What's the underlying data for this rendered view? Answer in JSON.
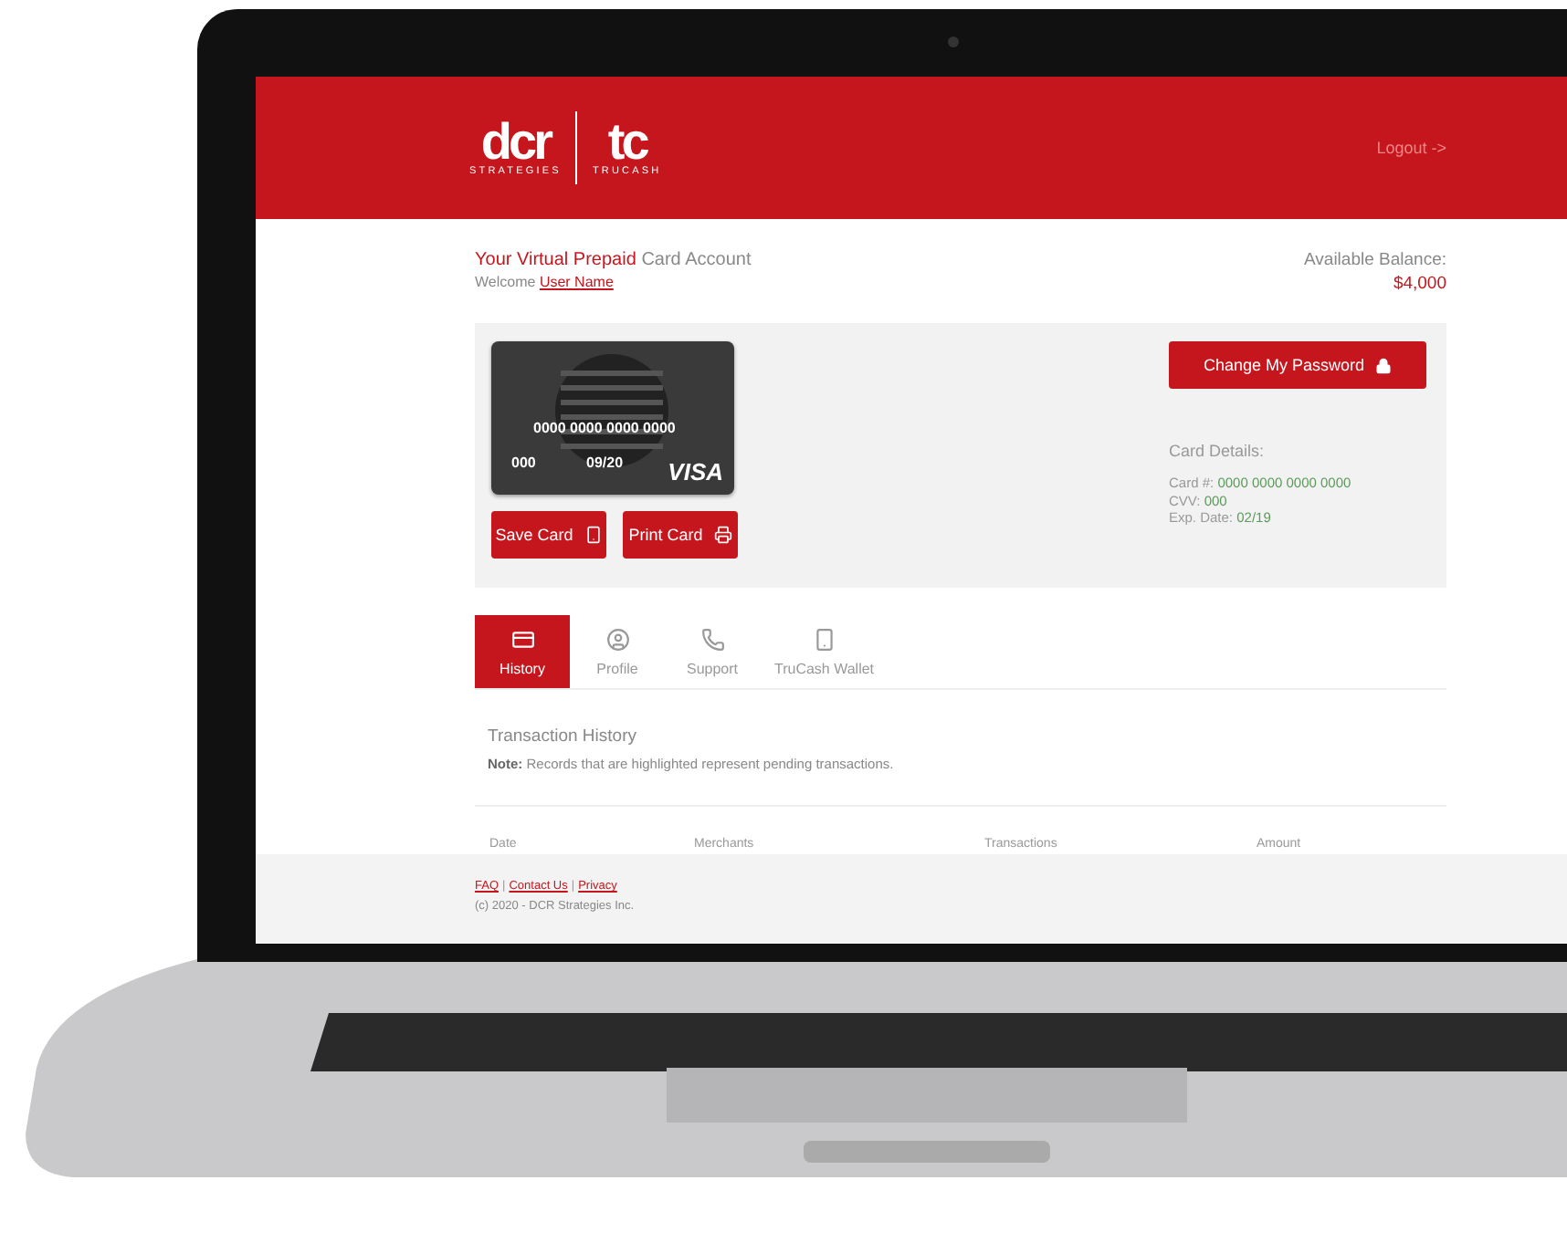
{
  "header": {
    "logo": {
      "left_mark": "dcr",
      "left_caption": "STRATEGIES",
      "right_mark": "tc",
      "right_caption": "TRUCASH"
    },
    "logout": "Logout ->"
  },
  "account": {
    "title_highlight": "Your Virtual Prepaid",
    "title_rest": "Card Account",
    "welcome": "Welcome",
    "user_name": "User Name",
    "balance_label": "Available Balance:",
    "balance": "$4,000"
  },
  "card": {
    "number": "0000 0000 0000 0000",
    "cvv": "000",
    "expiry": "09/20",
    "brand": "VISA"
  },
  "card_buttons": [
    {
      "label": "Save Card",
      "kind": "phone"
    },
    {
      "label": "Print Card",
      "kind": "printer"
    }
  ],
  "change_password": "Change My Password",
  "card_details": {
    "title": "Card Details:",
    "fields": [
      {
        "label": "Card #:",
        "value": "0000 0000 0000 0000"
      },
      {
        "label": "CVV:",
        "value": "000"
      },
      {
        "label": "Exp. Date:",
        "value": "02/19"
      }
    ]
  },
  "tabs": [
    {
      "label": "History",
      "selected": true,
      "kind": "card"
    },
    {
      "label": "Profile",
      "selected": false,
      "kind": "user"
    },
    {
      "label": "Support",
      "selected": false,
      "kind": "phone"
    },
    {
      "label": "TruCash Wallet",
      "selected": false,
      "kind": "mobile"
    }
  ],
  "history": {
    "title": "Transaction History",
    "note": "**Note:** Records that are highlighted represent pending transactions.",
    "columns": [
      "Date",
      "Merchants",
      "Transactions",
      "Amount"
    ]
  },
  "footer": {
    "links": [
      "FAQ",
      "Contact Us",
      "Privacy"
    ],
    "separator": "|",
    "copyright": "(c) 2020 - DCR Strategies Inc."
  }
}
